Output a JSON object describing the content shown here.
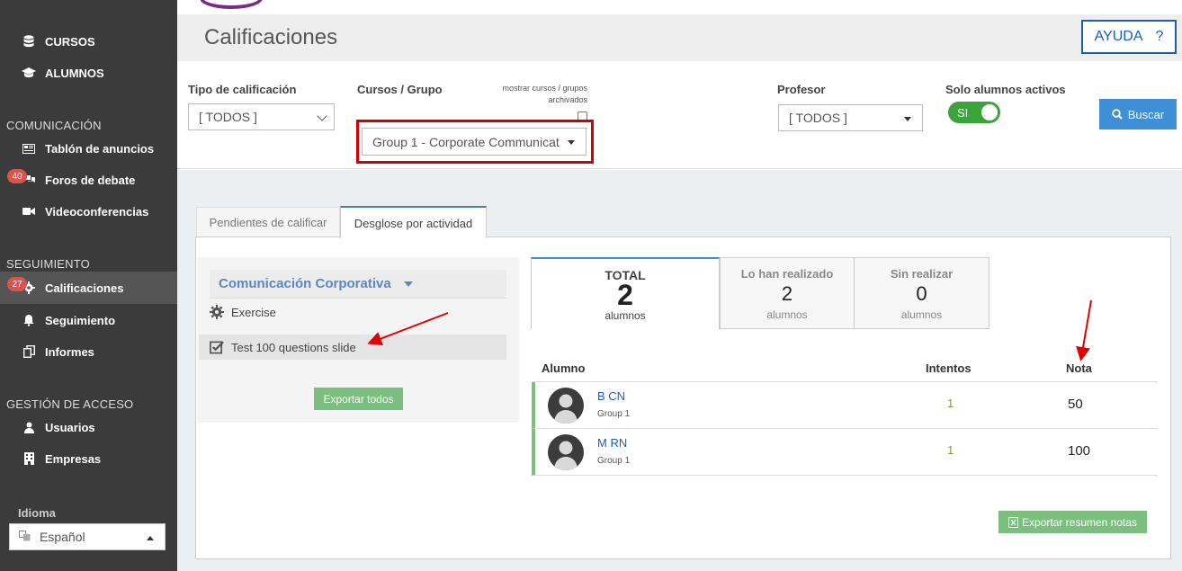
{
  "sidebar": {
    "items": [
      {
        "label": "CURSOS",
        "icon": "database-icon"
      },
      {
        "label": "ALUMNOS",
        "icon": "graduation-cap-icon"
      },
      {
        "label": "Tablón de anuncios",
        "icon": "newspaper-icon"
      },
      {
        "label": "Foros de debate",
        "icon": "comments-icon",
        "badge": "40"
      },
      {
        "label": "Videoconferencias",
        "icon": "video-camera-icon"
      },
      {
        "label": "Calificaciones",
        "icon": "gear-icon",
        "badge": "27"
      },
      {
        "label": "Seguimiento",
        "icon": "bell-icon"
      },
      {
        "label": "Informes",
        "icon": "copy-icon"
      },
      {
        "label": "Usuarios",
        "icon": "user-icon"
      },
      {
        "label": "Empresas",
        "icon": "building-icon"
      }
    ],
    "sections": {
      "comunicacion": "COMUNICACIÓN",
      "seguimiento": "SEGUIMIENTO",
      "gestion": "GESTIÓN DE ACCESO"
    },
    "language_label": "Idioma",
    "language_value": "Español"
  },
  "header": {
    "title": "Calificaciones",
    "help_label": "AYUDA",
    "help_icon": "?"
  },
  "filters": {
    "tipo_label": "Tipo de calificación",
    "tipo_value": "[ TODOS ]",
    "cursos_label": "Cursos / Grupo",
    "archived_note_line1": "mostrar cursos / grupos",
    "archived_note_line2": "archivados",
    "cursos_value": "Group 1 - Corporate Communicat",
    "profesor_label": "Profesor",
    "profesor_value": "[ TODOS ]",
    "activos_label": "Solo alumnos activos",
    "activos_toggle": "SI",
    "search_label": "Buscar"
  },
  "tabs": [
    {
      "label": "Pendientes de calificar"
    },
    {
      "label": "Desglose por actividad"
    }
  ],
  "activities": {
    "course": "Comunicación Corporativa",
    "items": [
      {
        "label": "Exercise",
        "icon": "gear-icon"
      },
      {
        "label": "Test 100 questions slide",
        "icon": "checkbox-checked-icon"
      }
    ],
    "export_all": "Exportar todos"
  },
  "stats": {
    "total_label": "TOTAL",
    "total_value": "2",
    "total_sub": "alumnos",
    "done_label": "Lo han realizado",
    "done_value": "2",
    "done_sub": "alumnos",
    "pending_label": "Sin realizar",
    "pending_value": "0",
    "pending_sub": "alumnos"
  },
  "table": {
    "headers": {
      "alumno": "Alumno",
      "intentos": "Intentos",
      "nota": "Nota"
    },
    "rows": [
      {
        "name": "B CN",
        "group": "Group 1",
        "tries": "1",
        "grade": "50"
      },
      {
        "name": "M RN",
        "group": "Group 1",
        "tries": "1",
        "grade": "100"
      }
    ]
  },
  "export_summary": "Exportar resumen notas",
  "colors": {
    "sidebar": "#3b3b3b",
    "accent_blue": "#3f8fd6",
    "export_green": "#7bbf7e",
    "annotation_red": "#d40000"
  }
}
